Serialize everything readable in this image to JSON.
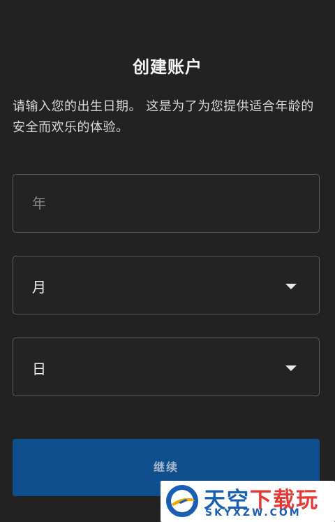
{
  "header": {
    "title": "创建账户"
  },
  "description": "请输入您的出生日期。 这是为了为您提供适合年龄的安全而欢乐的体验。",
  "form": {
    "year": {
      "placeholder": "年"
    },
    "month": {
      "value": "月",
      "icon": "chevron-down-icon"
    },
    "day": {
      "value": "日",
      "icon": "chevron-down-icon"
    },
    "continue_label": "继续"
  },
  "watermark": {
    "name_main": "天空",
    "name_accent": "下载玩",
    "url": "SKYXZW.COM"
  },
  "colors": {
    "background": "#222222",
    "field_border": "#5c5c5c",
    "button": "#0f4f8e",
    "button_text": "#a7b8cb"
  }
}
